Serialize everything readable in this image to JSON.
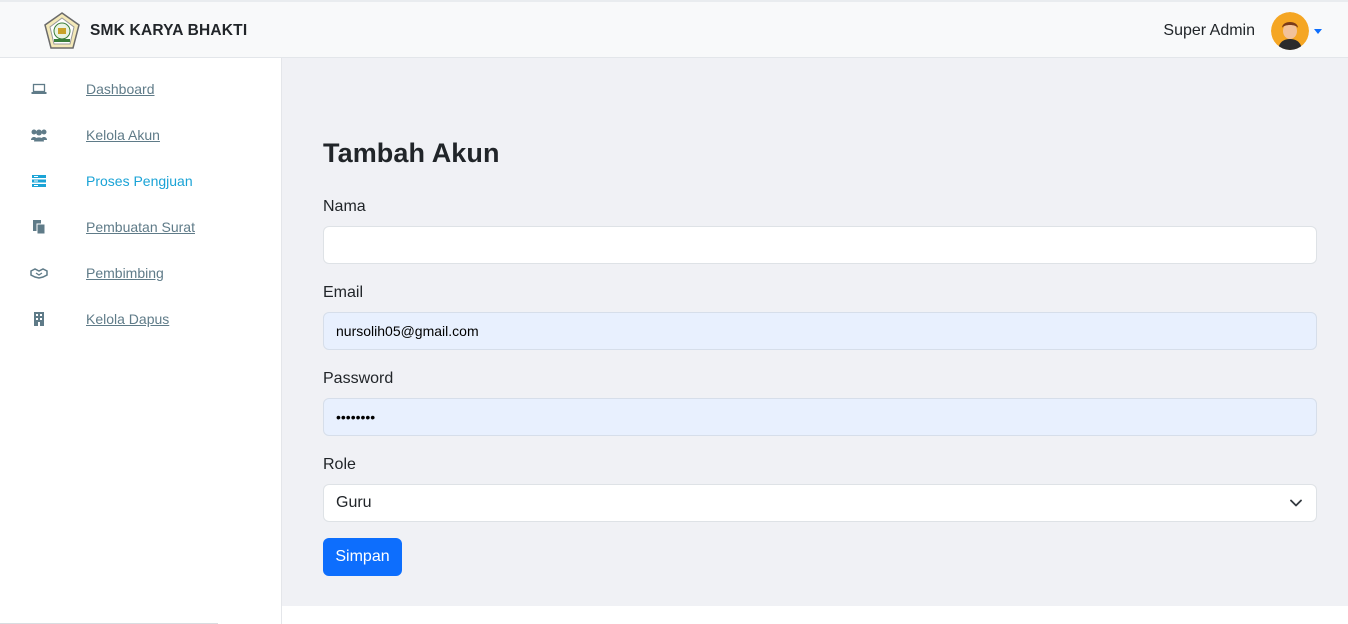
{
  "header": {
    "brand_name": "SMK KARYA BHAKTI",
    "brand_logo": "school-emblem-icon",
    "user_name": "Super Admin",
    "avatar": "user-avatar-icon"
  },
  "sidebar": {
    "items": [
      {
        "label": "Dashboard",
        "icon": "laptop-icon",
        "active": false
      },
      {
        "label": "Kelola Akun",
        "icon": "users-icon",
        "active": false
      },
      {
        "label": "Proses Pengjuan",
        "icon": "list-icon",
        "active": true
      },
      {
        "label": "Pembuatan Surat",
        "icon": "documents-icon",
        "active": false
      },
      {
        "label": "Pembimbing",
        "icon": "handshake-icon",
        "active": false
      },
      {
        "label": "Kelola Dapus",
        "icon": "building-icon",
        "active": false
      }
    ]
  },
  "form": {
    "title": "Tambah Akun",
    "nama_label": "Nama",
    "nama_value": "",
    "email_label": "Email",
    "email_value": "nursolih05@gmail.com",
    "password_label": "Password",
    "password_value": "••••••••",
    "role_label": "Role",
    "role_value": "Guru",
    "submit_label": "Simpan"
  },
  "colors": {
    "primary": "#0d6efd",
    "active_link": "#1aa3d6",
    "link": "#5f7b88",
    "main_bg": "#f0f1f5"
  }
}
